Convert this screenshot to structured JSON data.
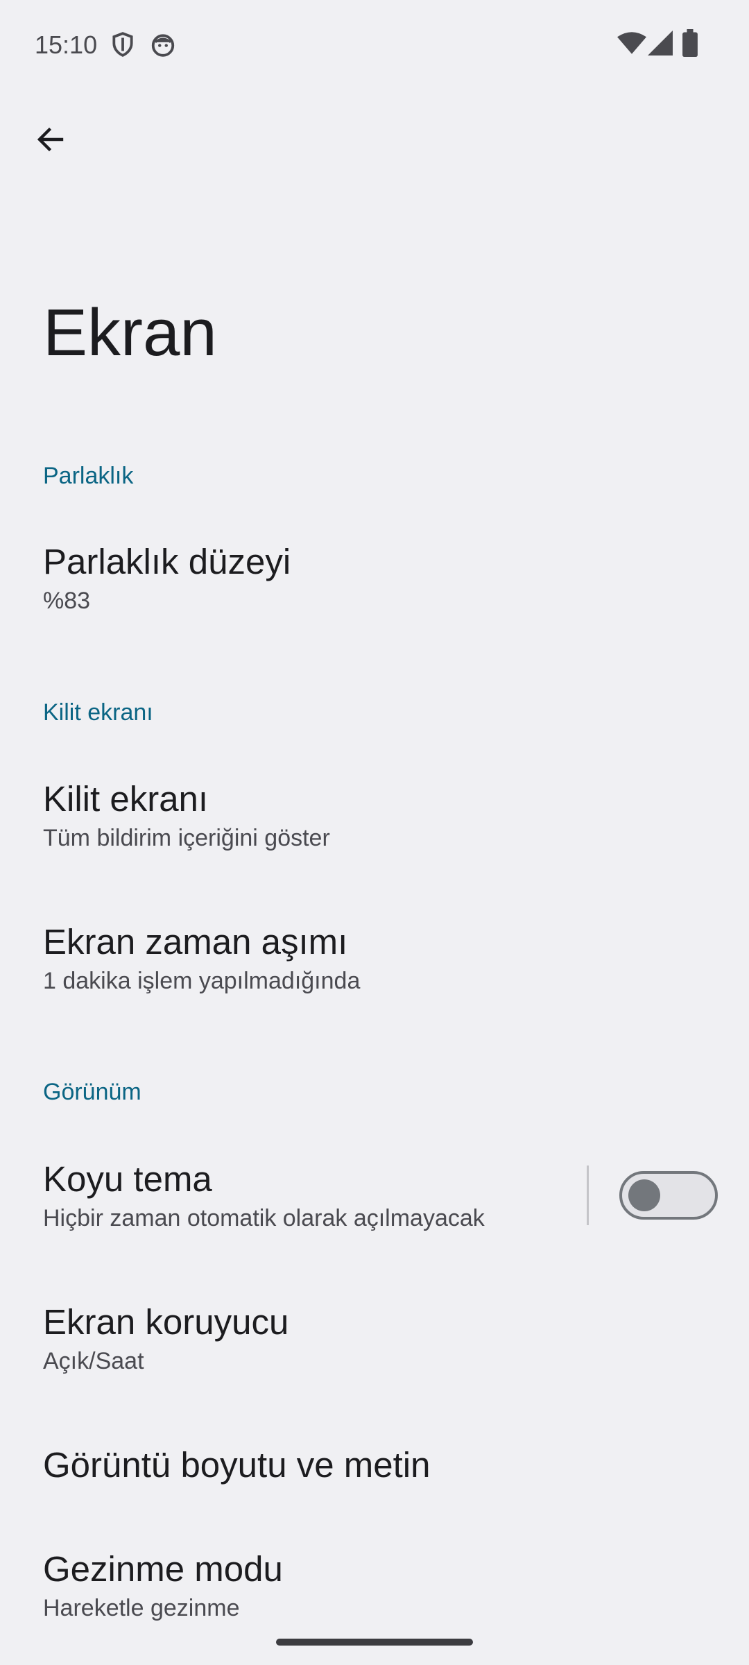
{
  "status_bar": {
    "time": "15:10",
    "icons_left": [
      "shield-icon",
      "face-icon"
    ],
    "icons_right": [
      "wifi-icon",
      "signal-icon",
      "battery-icon"
    ]
  },
  "header": {
    "back_icon": "arrow-left-icon",
    "title": "Ekran"
  },
  "sections": {
    "brightness": {
      "header": "Parlaklık",
      "level": {
        "title": "Parlaklık düzeyi",
        "summary": "%83"
      }
    },
    "lock_screen": {
      "header": "Kilit ekranı",
      "lock": {
        "title": "Kilit ekranı",
        "summary": "Tüm bildirim içeriğini göster"
      },
      "timeout": {
        "title": "Ekran zaman aşımı",
        "summary": "1 dakika işlem yapılmadığında"
      }
    },
    "appearance": {
      "header": "Görünüm",
      "dark_theme": {
        "title": "Koyu tema",
        "summary": "Hiçbir zaman otomatik olarak açılmayacak",
        "enabled": false
      },
      "screensaver": {
        "title": "Ekran koruyucu",
        "summary": "Açık/Saat"
      },
      "display_size": {
        "title": "Görüntü boyutu ve metin"
      },
      "navigation": {
        "title": "Gezinme modu",
        "summary": "Hareketle gezinme"
      }
    }
  },
  "colors": {
    "background": "#f0f0f3",
    "accent": "#0b6584",
    "switch_off": "#73777c"
  }
}
